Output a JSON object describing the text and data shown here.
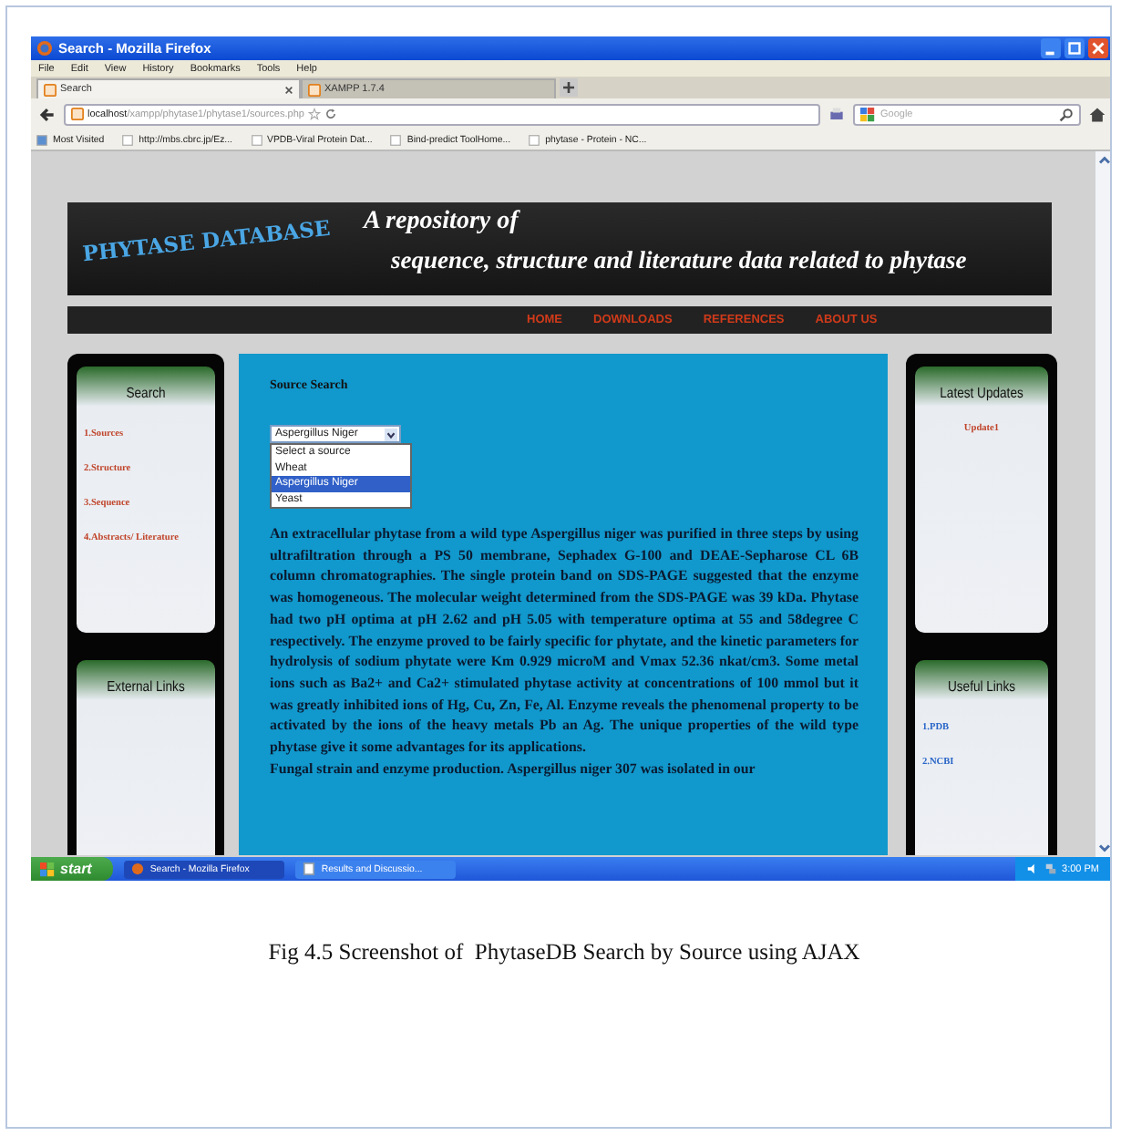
{
  "window": {
    "title": "Search - Mozilla Firefox"
  },
  "menu": [
    "File",
    "Edit",
    "View",
    "History",
    "Bookmarks",
    "Tools",
    "Help"
  ],
  "tabs": [
    {
      "label": "Search",
      "selected": true
    },
    {
      "label": "XAMPP 1.7.4",
      "selected": false
    }
  ],
  "address": {
    "host": "localhost",
    "path": "/xampp/phytase1/phytase1/sources.php"
  },
  "search": {
    "placeholder": "Google"
  },
  "bookmarks": [
    "Most Visited",
    "http://mbs.cbrc.jp/Ez...",
    "VPDB-Viral Protein Dat...",
    "Bind-predict ToolHome...",
    "phytase - Protein - NC..."
  ],
  "site": {
    "logo": "PHYTASE DATABASE",
    "tagline_1": "A repository of",
    "tagline_2": "sequence, structure and literature data related to phytase",
    "nav": [
      "HOME",
      "DOWNLOADS",
      "REFERENCES",
      "ABOUT US"
    ],
    "left_panels": [
      {
        "title": "Search",
        "links": [
          "1.Sources",
          "2.Structure",
          "3.Sequence",
          "4.Abstracts/ Literature"
        ]
      },
      {
        "title": "External Links"
      }
    ],
    "right_panels": [
      {
        "title": "Latest Updates",
        "links": [
          "Update1"
        ],
        "kind": "update"
      },
      {
        "title": "Useful Links",
        "links": [
          "1.PDB",
          "2.NCBI"
        ],
        "kind": "link"
      }
    ],
    "main": {
      "heading": "Source Search",
      "select_value": "Aspergillus Niger",
      "options": [
        {
          "label": "Select a source",
          "selected": false
        },
        {
          "label": "Wheat",
          "selected": false
        },
        {
          "label": "Aspergillus Niger",
          "selected": true
        },
        {
          "label": "Yeast",
          "selected": false
        }
      ],
      "paragraphs": [
        "An extracellular phytase from a wild type Aspergillus niger was purified in three steps by using ultrafiltration through a PS 50 membrane, Sephadex G-100 and DEAE-Sepharose CL 6B column chromatographies. The single protein band on SDS-PAGE suggested that the enzyme was homogeneous. The molecular weight determined from the SDS-PAGE was 39 kDa. Phytase had two pH optima at pH 2.62 and pH 5.05 with temperature optima at 55 and 58degree C respectively. The enzyme proved to be fairly specific for phytate, and the kinetic parameters for hydrolysis of sodium phytate were Km 0.929 microM and Vmax 52.36 nkat/cm3. Some metal ions such as Ba2+ and Ca2+ stimulated phytase activity at concentrations of 100 mmol but it was greatly inhibited ions of Hg, Cu, Zn, Fe, Al. Enzyme reveals the phenomenal property to be activated by the ions of the heavy metals Pb an Ag. The unique properties of the wild type phytase give it some advantages for its applications.",
        "Fungal strain and enzyme production. Aspergillus niger 307 was isolated in our"
      ]
    }
  },
  "taskbar": {
    "start": "start",
    "tasks": [
      {
        "label": "Search - Mozilla Firefox",
        "selected": true
      },
      {
        "label": "Results and Discussio...",
        "selected": false
      }
    ],
    "clock": "3:00 PM"
  },
  "caption": "Fig 4.5 Screenshot of  PhytaseDB Search by Source using AJAX"
}
